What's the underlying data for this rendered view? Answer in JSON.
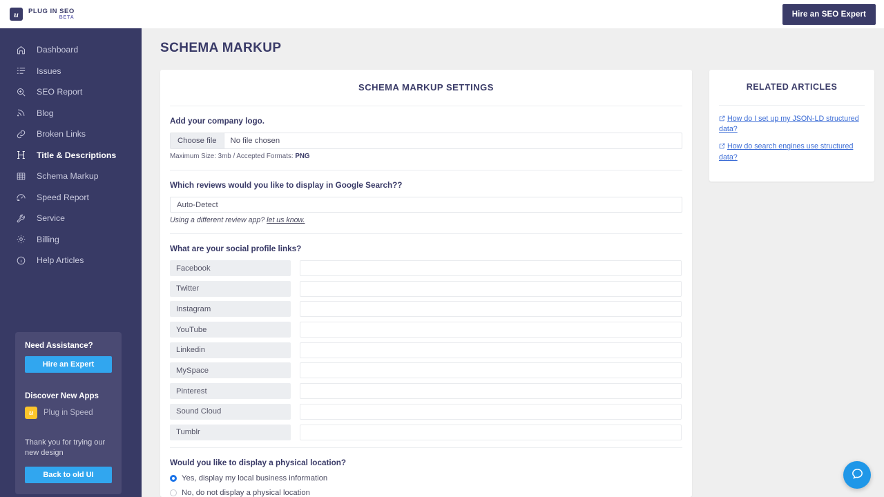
{
  "topbar": {
    "brand_name": "PLUG IN SEO",
    "brand_beta": "BETA",
    "brand_glyph": "u",
    "hire_button": "Hire an SEO Expert"
  },
  "sidebar": {
    "items": [
      {
        "label": "Dashboard",
        "icon": "home-icon",
        "active": false
      },
      {
        "label": "Issues",
        "icon": "list-icon",
        "active": false
      },
      {
        "label": "SEO Report",
        "icon": "search-plus-icon",
        "active": false
      },
      {
        "label": "Blog",
        "icon": "rss-icon",
        "active": false
      },
      {
        "label": "Broken Links",
        "icon": "link-icon",
        "active": false
      },
      {
        "label": "Title & Descriptions",
        "icon": "heading-icon",
        "active": true
      },
      {
        "label": "Schema Markup",
        "icon": "table-icon",
        "active": false
      },
      {
        "label": "Speed Report",
        "icon": "speedometer-icon",
        "active": false
      },
      {
        "label": "Service",
        "icon": "wrench-icon",
        "active": false
      },
      {
        "label": "Billing",
        "icon": "gear-icon",
        "active": false
      },
      {
        "label": "Help Articles",
        "icon": "info-icon",
        "active": false
      }
    ],
    "assist": {
      "need_assistance_heading": "Need Assistance?",
      "hire_expert_button": "Hire an Expert",
      "discover_heading": "Discover New Apps",
      "app_name": "Plug in Speed",
      "app_glyph": "u",
      "thanks_note": "Thank you for trying our new design",
      "back_button": "Back to old UI"
    }
  },
  "main": {
    "page_title": "SCHEMA MARKUP",
    "card_title": "SCHEMA MARKUP SETTINGS",
    "logo_section": {
      "label": "Add your company logo.",
      "choose_file_button": "Choose file",
      "file_status": "No file chosen",
      "hint_prefix": "Maximum Size: 3mb / Accepted Formats: ",
      "hint_format": "PNG"
    },
    "reviews_section": {
      "label": "Which reviews would you like to display in Google Search??",
      "selected_value": "Auto-Detect",
      "note_prefix": "Using a different review app? ",
      "note_link": "let us know."
    },
    "social_section": {
      "label": "What are your social profile links?",
      "rows": [
        {
          "label": "Facebook",
          "value": ""
        },
        {
          "label": "Twitter",
          "value": ""
        },
        {
          "label": "Instagram",
          "value": ""
        },
        {
          "label": "YouTube",
          "value": ""
        },
        {
          "label": "Linkedin",
          "value": ""
        },
        {
          "label": "MySpace",
          "value": ""
        },
        {
          "label": "Pinterest",
          "value": ""
        },
        {
          "label": "Sound Cloud",
          "value": ""
        },
        {
          "label": "Tumblr",
          "value": ""
        }
      ]
    },
    "location_section": {
      "label": "Would you like to display a physical location?",
      "options": [
        {
          "label": "Yes, display my local business information",
          "selected": true
        },
        {
          "label": "No, do not display a physical location",
          "selected": false
        }
      ]
    }
  },
  "aside": {
    "title": "RELATED ARTICLES",
    "articles": [
      {
        "text": "How do I set up my JSON-LD structured data?"
      },
      {
        "text": "How do search engines use structured data?"
      }
    ]
  },
  "help": {
    "icon": "chat-help-icon"
  },
  "colors": {
    "sidebar_bg": "#383a65",
    "brand_navy": "#3a3b68",
    "accent_blue": "#31a6ef",
    "link_blue": "#3b6cd6",
    "radio_blue": "#1a73e8",
    "app_yellow": "#fcc52b",
    "page_bg": "#efefef"
  }
}
